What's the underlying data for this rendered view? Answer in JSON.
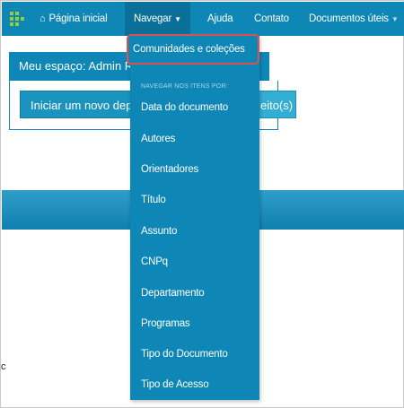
{
  "navbar": {
    "home_label": "Página inicial",
    "browse_label": "Navegar",
    "help_label": "Ajuda",
    "contact_label": "Contato",
    "docs_label": "Documentos úteis"
  },
  "content": {
    "myspace_title": "Meu espaço: Admin R",
    "start_button_label": "Iniciar um novo depó",
    "start_button_tail": "eito(s)"
  },
  "dropdown": {
    "highlighted_item": "Comunidades e coleções",
    "section_header": "NAVEGAR NOS ITENS POR:",
    "items": [
      "Data do documento",
      "Autores",
      "Orientadores",
      "Título",
      "Assunto",
      "CNPq",
      "Departamento",
      "Programas",
      "Tipo do Documento",
      "Tipo de Acesso"
    ]
  },
  "misc": {
    "stray_char": "c"
  },
  "colors": {
    "primary": "#0e86b6",
    "highlight_border": "#d9534f",
    "logo_green": "#9acd32"
  },
  "icons": {
    "logo": "dots-logo-icon",
    "home": "home-icon",
    "caret": "caret-down-icon"
  }
}
